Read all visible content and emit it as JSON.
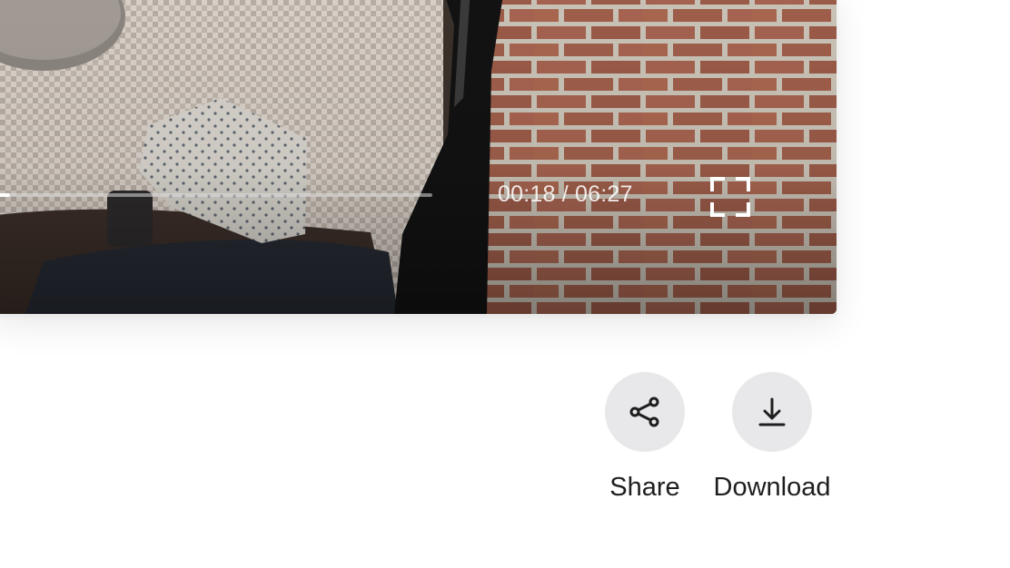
{
  "player": {
    "progress": 0.0465,
    "time_readout": "00:18 / 06:27",
    "fullscreen_icon": "fullscreen-icon"
  },
  "actions": {
    "share": {
      "label": "Share",
      "icon": "share-icon"
    },
    "download": {
      "label": "Download",
      "icon": "download-icon"
    }
  },
  "colors": {
    "button_bg": "#e8e8ea",
    "label_text": "#1e1e1e",
    "timeline_track": "#c8c8c8",
    "time_text": "#e0e0e0"
  }
}
